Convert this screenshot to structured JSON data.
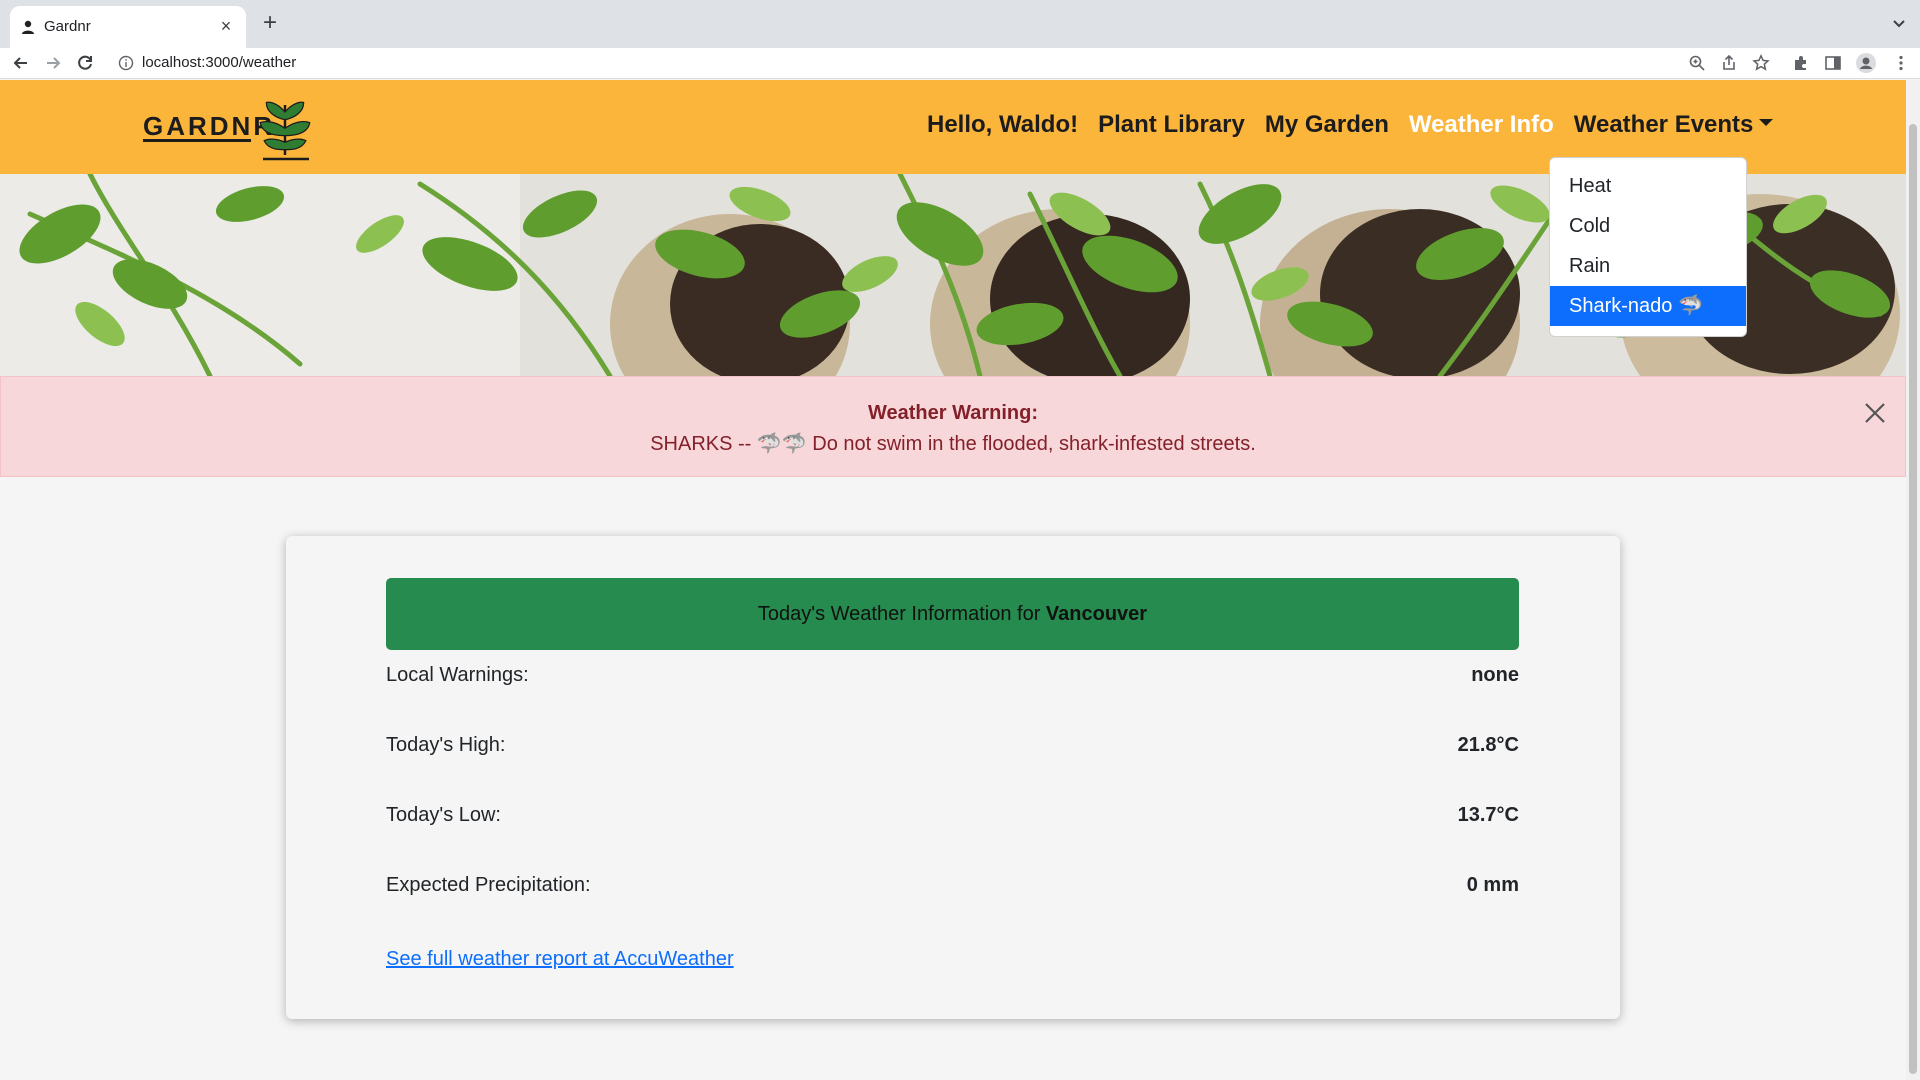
{
  "browser": {
    "tab_title": "Gardnr",
    "new_tab_glyph": "+",
    "close_glyph": "×",
    "url": "localhost:3000/weather"
  },
  "navbar": {
    "logo_text": "GARDNR",
    "greeting": "Hello, Waldo!",
    "links": [
      "Plant Library",
      "My Garden",
      "Weather Info",
      "Weather Events"
    ],
    "active_link": "Weather Info",
    "brand_color": "#fcb53b"
  },
  "dropdown": {
    "items": [
      "Heat",
      "Cold",
      "Rain",
      "Shark-nado 🦈"
    ],
    "active_item": "Shark-nado 🦈",
    "active_color": "#0d6efd"
  },
  "alert": {
    "title": "Weather Warning:",
    "message": "SHARKS -- 🦈🦈 Do not swim in the flooded, shark-infested streets.",
    "background": "#f8d7da",
    "text_color": "#842029"
  },
  "weather": {
    "header_prefix": "Today's Weather Information for ",
    "city": "Vancouver",
    "header_color": "#258b4e",
    "rows": [
      {
        "label": "Local Warnings:",
        "value": "none"
      },
      {
        "label": "Today's High:",
        "value": "21.8°C"
      },
      {
        "label": "Today's Low:",
        "value": "13.7°C"
      },
      {
        "label": "Expected Precipitation:",
        "value": "0 mm"
      }
    ],
    "report_link": "See full weather report at AccuWeather"
  }
}
